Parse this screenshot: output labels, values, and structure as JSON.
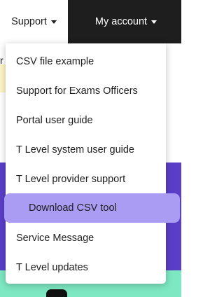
{
  "nav": {
    "support_label": "Support",
    "account_label": "My account"
  },
  "dropdown": {
    "items": [
      {
        "label": "CSV file example"
      },
      {
        "label": "Support for Exams Officers"
      },
      {
        "label": "Portal user guide"
      },
      {
        "label": "T Level system user guide"
      },
      {
        "label": "T Level provider support"
      },
      {
        "label": "Download CSV tool"
      },
      {
        "label": "Service Message"
      },
      {
        "label": "T Level updates"
      }
    ],
    "active_index": 5
  },
  "background": {
    "fragment_text": "r"
  },
  "colors": {
    "topbar": "#1e1e1e",
    "highlight": "#a99cf2",
    "purple_band": "#5a3ec8",
    "green_band": "#7de8c2"
  },
  "icons": {
    "support_caret": "caret-down-icon",
    "account_caret": "caret-down-icon"
  }
}
